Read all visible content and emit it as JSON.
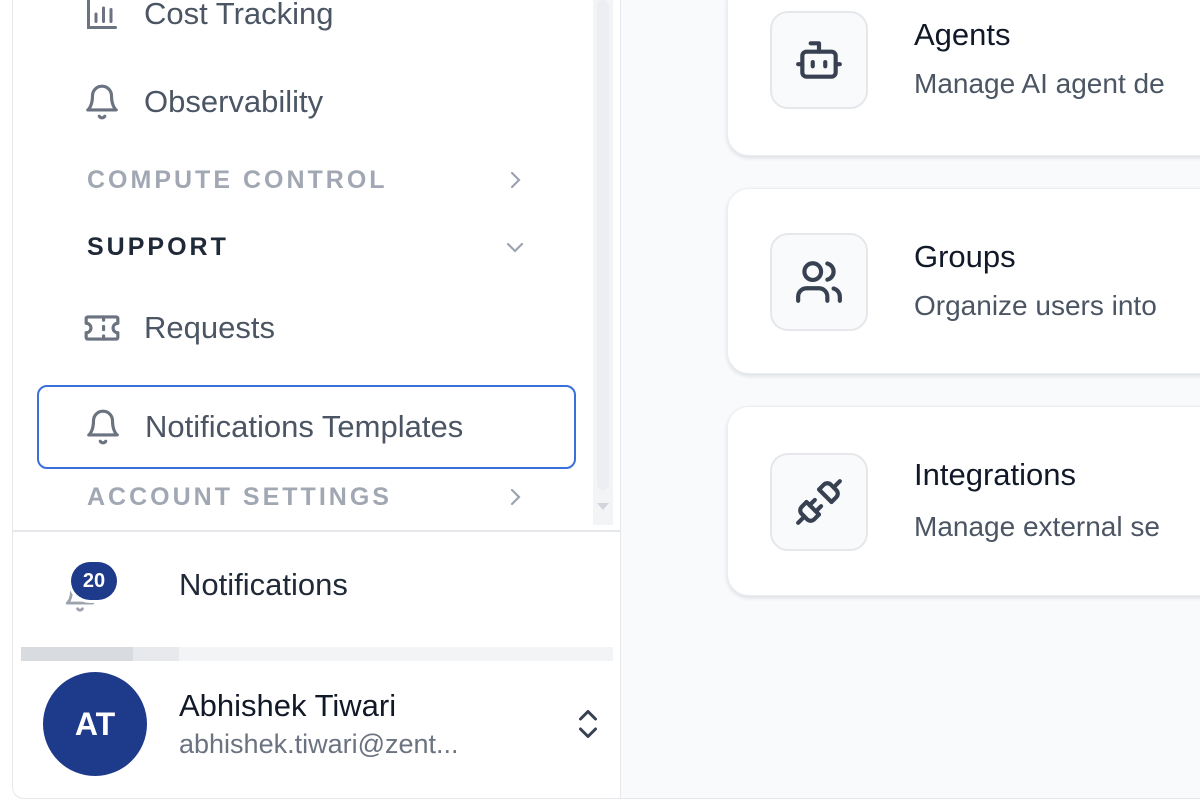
{
  "sidebar": {
    "nav_top": [
      {
        "label": "Cost Tracking",
        "icon": "bar-chart-icon"
      },
      {
        "label": "Observability",
        "icon": "bell-icon"
      }
    ],
    "sections": {
      "compute_control": "COMPUTE CONTROL",
      "support": "SUPPORT",
      "account_settings": "ACCOUNT SETTINGS"
    },
    "support_items": [
      {
        "label": "Requests",
        "icon": "ticket-icon"
      },
      {
        "label": "Notifications Templates",
        "icon": "bell-icon",
        "active": true
      }
    ],
    "notifications": {
      "label": "Notifications",
      "count": "20"
    },
    "user": {
      "initials": "AT",
      "name": "Abhishek Tiwari",
      "email": "abhishek.tiwari@zent..."
    }
  },
  "main": {
    "cards": [
      {
        "title": "Agents",
        "description": "Manage AI agent de",
        "icon": "bot-icon"
      },
      {
        "title": "Groups",
        "description": "Organize users into",
        "icon": "users-icon"
      },
      {
        "title": "Integrations",
        "description": "Manage external se",
        "icon": "plug-icon"
      }
    ]
  },
  "colors": {
    "accent": "#3b6fd9",
    "badge": "#1e3a8a",
    "avatar": "#1e3a8a"
  }
}
